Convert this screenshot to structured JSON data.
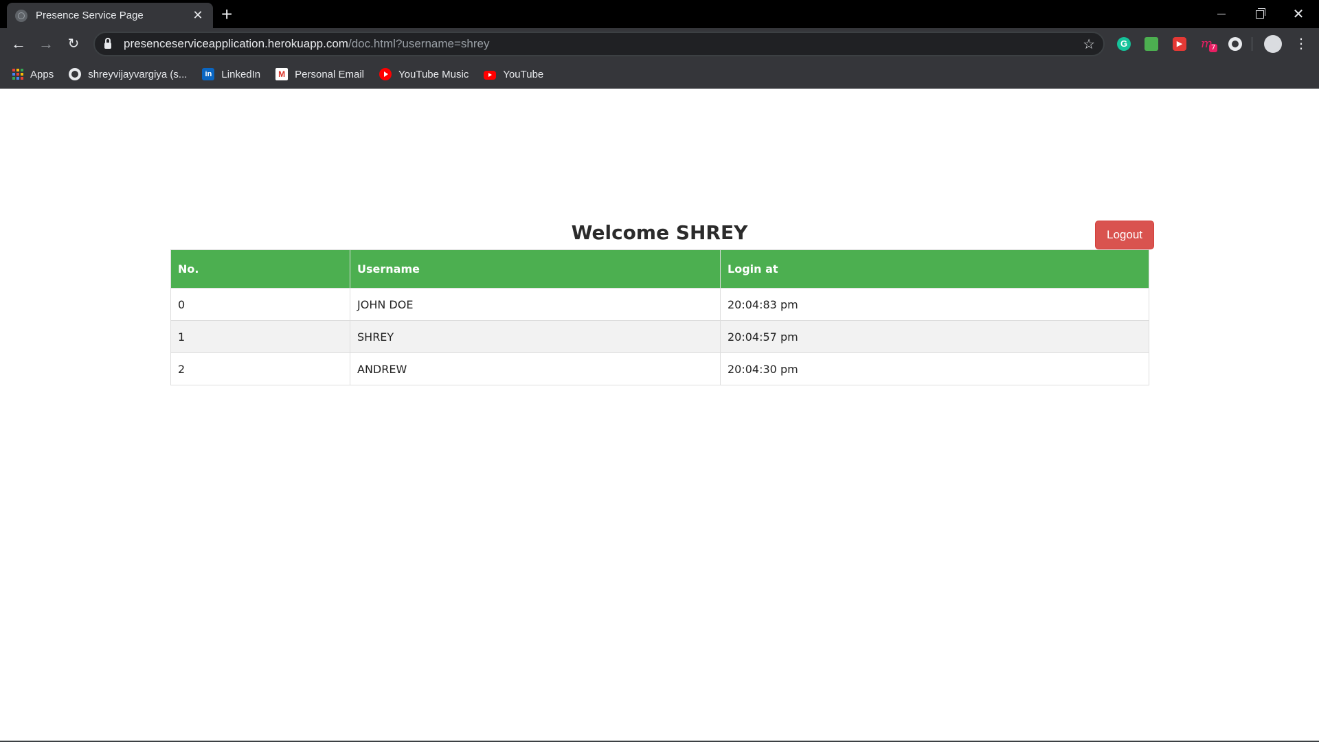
{
  "browser": {
    "tab_title": "Presence Service Page",
    "tab_close": "✕",
    "new_tab": "+",
    "url_host": "presenceserviceapplication.herokuapp.com",
    "url_path": "/doc.html?username=shrey",
    "bookmark_star": "☆",
    "extensions": {
      "grammarly": "G",
      "m_badge": "7"
    },
    "bookmarks": [
      {
        "label": "Apps",
        "icon": "apps-grid-icon"
      },
      {
        "label": "shreyvijayvargiya (s...",
        "icon": "github-icon"
      },
      {
        "label": "LinkedIn",
        "icon": "linkedin-icon"
      },
      {
        "label": "Personal Email",
        "icon": "gmail-icon"
      },
      {
        "label": "YouTube Music",
        "icon": "youtube-music-icon"
      },
      {
        "label": "YouTube",
        "icon": "youtube-icon"
      }
    ]
  },
  "page": {
    "welcome": "Welcome SHREY",
    "logout_label": "Logout",
    "table": {
      "headers": [
        "No.",
        "Username",
        "Login at"
      ],
      "rows": [
        [
          "0",
          "JOHN DOE",
          "20:04:83 pm"
        ],
        [
          "1",
          "SHREY",
          "20:04:57 pm"
        ],
        [
          "2",
          "ANDREW",
          "20:04:30 pm"
        ]
      ]
    }
  },
  "colors": {
    "header_green": "#4caf50",
    "logout_red": "#d9534f",
    "chrome_dark": "#35363a"
  }
}
